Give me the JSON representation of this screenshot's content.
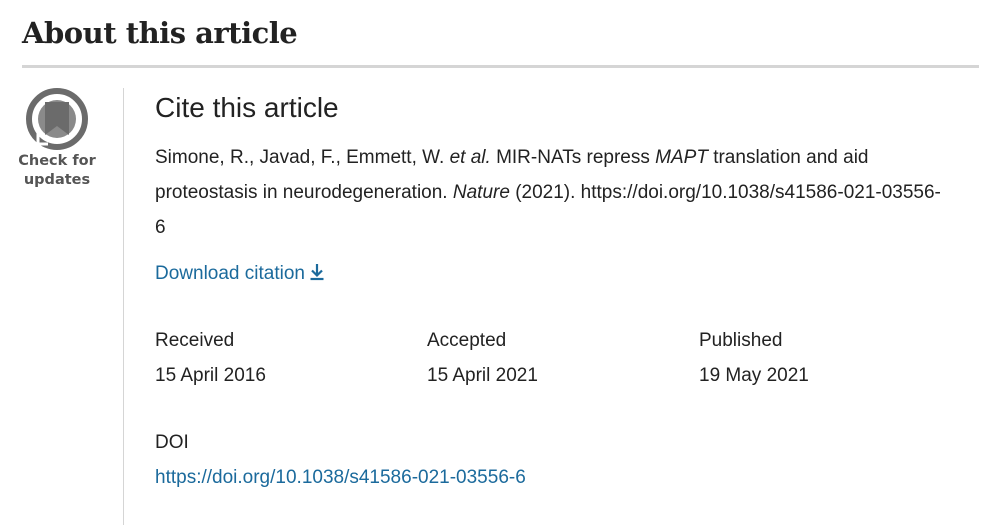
{
  "section": {
    "title": "About this article"
  },
  "badge": {
    "icon": "check-for-updates-icon",
    "line1": "Check for",
    "line2": "updates"
  },
  "cite": {
    "heading": "Cite this article",
    "authors": "Simone, R., Javad, F., Emmett, W.",
    "et_al": "et al.",
    "title_part1": "MIR-NATs repress",
    "title_gene": "MAPT",
    "title_part2": "translation and aid proteostasis in neurodegeneration.",
    "journal": "Nature",
    "year": "(2021).",
    "url": "https://doi.org/10.1038/s41586-021-03556-6",
    "download_label": "Download citation",
    "download_icon": "download-icon"
  },
  "dates": [
    {
      "label": "Received",
      "value": "15 April 2016"
    },
    {
      "label": "Accepted",
      "value": "15 April 2021"
    },
    {
      "label": "Published",
      "value": "19 May 2021"
    }
  ],
  "doi": {
    "label": "DOI",
    "link": "https://doi.org/10.1038/s41586-021-03556-6"
  },
  "colors": {
    "link": "#1b6a9c",
    "text": "#222222",
    "rule": "#d5d5d5",
    "badge_gray": "#555555"
  }
}
